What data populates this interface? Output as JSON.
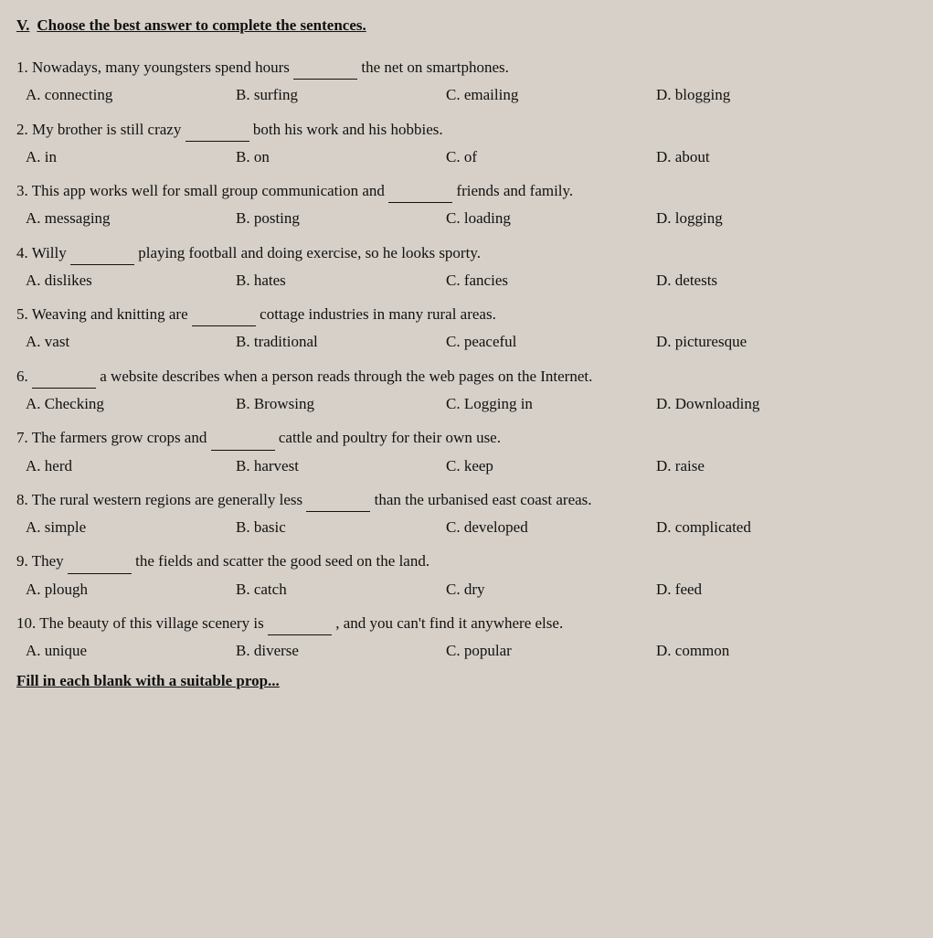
{
  "section": {
    "label": "V.",
    "title": "Choose the best answer to complete the sentences."
  },
  "questions": [
    {
      "num": "1.",
      "text_before": "Nowadays, many youngsters spend hours",
      "blank": true,
      "text_after": "the net on smartphones.",
      "options": [
        {
          "letter": "A.",
          "text": "connecting"
        },
        {
          "letter": "B.",
          "text": "surfing"
        },
        {
          "letter": "C.",
          "text": "emailing"
        },
        {
          "letter": "D.",
          "text": "blogging"
        }
      ]
    },
    {
      "num": "2.",
      "text_before": "My brother is still crazy",
      "blank": true,
      "text_after": "both his work and his hobbies.",
      "options": [
        {
          "letter": "A.",
          "text": "in"
        },
        {
          "letter": "B.",
          "text": "on"
        },
        {
          "letter": "C.",
          "text": "of"
        },
        {
          "letter": "D.",
          "text": "about"
        }
      ]
    },
    {
      "num": "3.",
      "text_before": "This app works well for small group communication and",
      "blank": true,
      "text_after": "friends and family.",
      "options": [
        {
          "letter": "A.",
          "text": "messaging"
        },
        {
          "letter": "B.",
          "text": "posting"
        },
        {
          "letter": "C.",
          "text": "loading"
        },
        {
          "letter": "D.",
          "text": "logging"
        }
      ]
    },
    {
      "num": "4.",
      "text_before": "Willy",
      "blank": true,
      "text_after": "playing football and doing exercise, so he looks sporty.",
      "options": [
        {
          "letter": "A.",
          "text": "dislikes"
        },
        {
          "letter": "B.",
          "text": "hates"
        },
        {
          "letter": "C.",
          "text": "fancies"
        },
        {
          "letter": "D.",
          "text": "detests"
        }
      ]
    },
    {
      "num": "5.",
      "text_before": "Weaving and knitting are",
      "blank": true,
      "text_after": "cottage industries in many rural areas.",
      "options": [
        {
          "letter": "A.",
          "text": "vast"
        },
        {
          "letter": "B.",
          "text": "traditional"
        },
        {
          "letter": "C.",
          "text": "peaceful"
        },
        {
          "letter": "D.",
          "text": "picturesque"
        }
      ]
    },
    {
      "num": "6.",
      "text_before": "",
      "blank": true,
      "text_after": "a website describes when a person reads through the web pages on the Internet.",
      "options": [
        {
          "letter": "A.",
          "text": "Checking"
        },
        {
          "letter": "B.",
          "text": "Browsing"
        },
        {
          "letter": "C.",
          "text": "Logging in"
        },
        {
          "letter": "D.",
          "text": "Downloading"
        }
      ]
    },
    {
      "num": "7.",
      "text_before": "The farmers grow crops and",
      "blank": true,
      "text_after": "cattle and poultry for their own use.",
      "options": [
        {
          "letter": "A.",
          "text": "herd"
        },
        {
          "letter": "B.",
          "text": "harvest"
        },
        {
          "letter": "C.",
          "text": "keep"
        },
        {
          "letter": "D.",
          "text": "raise"
        }
      ]
    },
    {
      "num": "8.",
      "text_before": "The rural western regions are generally less",
      "blank": true,
      "text_after": "than the urbanised east coast areas.",
      "options": [
        {
          "letter": "A.",
          "text": "simple"
        },
        {
          "letter": "B.",
          "text": "basic"
        },
        {
          "letter": "C.",
          "text": "developed"
        },
        {
          "letter": "D.",
          "text": "complicated"
        }
      ]
    },
    {
      "num": "9.",
      "text_before": "They",
      "blank": true,
      "text_after": "the fields and scatter the good seed on the land.",
      "options": [
        {
          "letter": "A.",
          "text": "plough"
        },
        {
          "letter": "B.",
          "text": "catch"
        },
        {
          "letter": "C.",
          "text": "dry"
        },
        {
          "letter": "D.",
          "text": "feed"
        }
      ]
    },
    {
      "num": "10.",
      "text_before": "The beauty of this village scenery is",
      "blank": true,
      "text_after": ", and you can't find it anywhere else.",
      "options": [
        {
          "letter": "A.",
          "text": "unique"
        },
        {
          "letter": "B.",
          "text": "diverse"
        },
        {
          "letter": "C.",
          "text": "popular"
        },
        {
          "letter": "D.",
          "text": "common"
        }
      ]
    }
  ],
  "fill_in_title": "Fill in each blank with a suitable prop..."
}
